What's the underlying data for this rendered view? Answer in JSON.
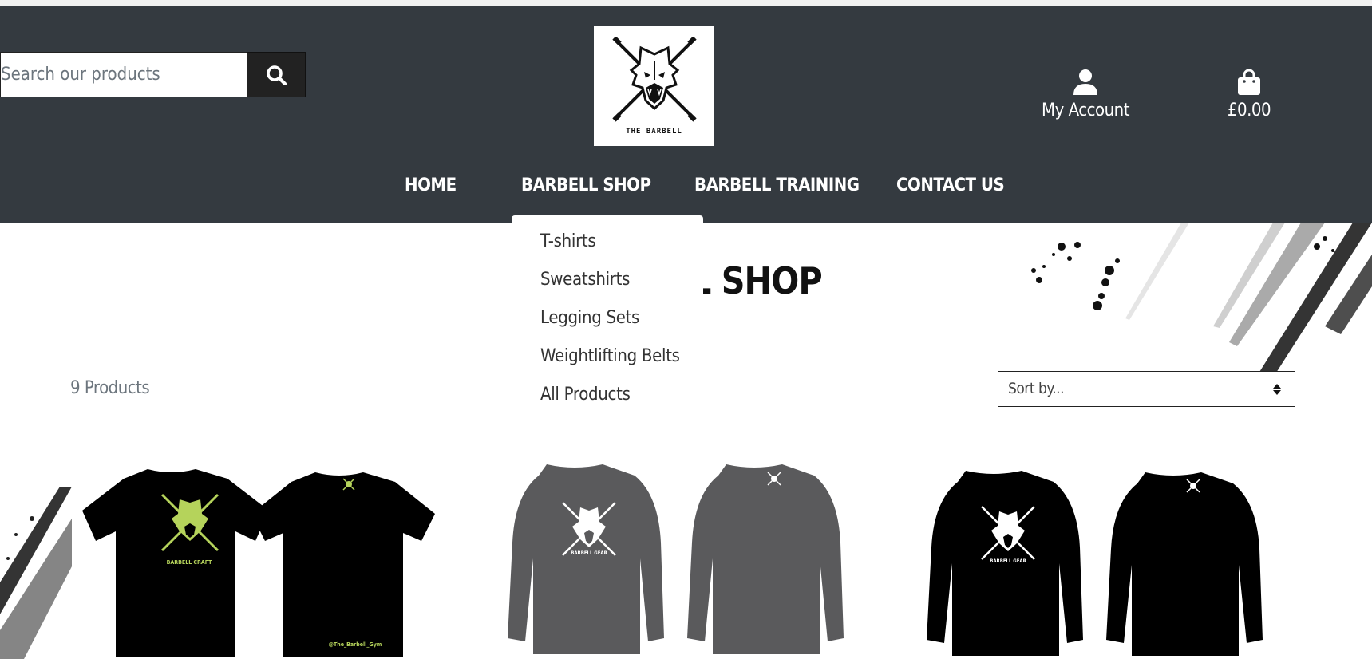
{
  "search": {
    "placeholder": "Search our products"
  },
  "logo": {
    "text": "THE BARBELL"
  },
  "account": {
    "label": "My Account",
    "icon": "user-icon"
  },
  "cart": {
    "total": "£0.00",
    "icon": "shopping-bag-icon"
  },
  "nav": {
    "items": [
      {
        "label": "HOME"
      },
      {
        "label": "BARBELL SHOP"
      },
      {
        "label": "BARBELL TRAINING"
      },
      {
        "label": "CONTACT US"
      }
    ]
  },
  "dropdown": {
    "items": [
      {
        "label": "T-shirts"
      },
      {
        "label": "Sweatshirts"
      },
      {
        "label": "Legging Sets"
      },
      {
        "label": "Weightlifting Belts"
      },
      {
        "label": "All Products"
      }
    ]
  },
  "page": {
    "title": "BARBELL SHOP"
  },
  "products": {
    "count_label": "9 Products",
    "sort_label": "Sort by...",
    "items": [
      {
        "front_text": "BARBELL CRAFT",
        "back_text": "@The_Barbell_Gym",
        "color": "#000000",
        "accent": "#b5d35b"
      },
      {
        "front_text": "BARBELL GEAR",
        "color": "#5a5a5c",
        "accent": "#ffffff"
      },
      {
        "front_text": "BARBELL GEAR",
        "color": "#000000",
        "accent": "#ffffff"
      }
    ]
  },
  "colors": {
    "header_bg": "#343a40",
    "search_button_bg": "#222222"
  }
}
